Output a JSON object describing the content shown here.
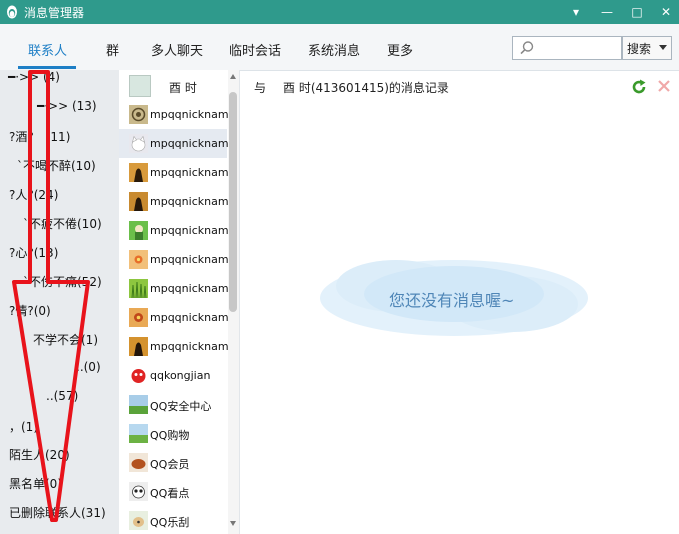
{
  "window": {
    "title": "消息管理器",
    "controls": [
      "▾",
      "—",
      "□",
      "✕"
    ]
  },
  "toolbar": {
    "tabs": [
      {
        "label": "联系人",
        "active": true
      },
      {
        "label": "群"
      },
      {
        "label": "多人聊天"
      },
      {
        "label": "临时会话"
      },
      {
        "label": "系统消息"
      },
      {
        "label": "更多"
      }
    ],
    "search_placeholder": "",
    "search_button": "搜索"
  },
  "left_panel": {
    "items": [
      {
        "label": "━·>> (4)"
      },
      {
        "label": "━·>> (13)"
      },
      {
        "label": "?酒?　(11)"
      },
      {
        "label": "ˋ不喝不醉(10)"
      },
      {
        "label": "?人?(24)"
      },
      {
        "label": "ˋ不疲不倦(10)"
      },
      {
        "label": "?心?(13)"
      },
      {
        "label": "ˋ不伤不痛(52)"
      },
      {
        "label": "?情?(0)"
      },
      {
        "label": "不学不会(1)"
      },
      {
        "label": "..(0)"
      },
      {
        "label": "..(57)"
      },
      {
        "label": "，(1)"
      },
      {
        "label": "陌生人(20)"
      },
      {
        "label": "黑名单(0)"
      },
      {
        "label": "已删除联系人(31)"
      }
    ]
  },
  "contact_list": {
    "header_name": "酉 时",
    "items": [
      {
        "name": "mpqqnickname",
        "avatar": "spiral-avatar"
      },
      {
        "name": "mpqqnickname",
        "avatar": "cat-avatar"
      },
      {
        "name": "mpqqnickname",
        "avatar": "silhouette-avatar"
      },
      {
        "name": "mpqqnickname",
        "avatar": "silhouette-avatar"
      },
      {
        "name": "mpqqnickname",
        "avatar": "green-avatar"
      },
      {
        "name": "mpqqnickname",
        "avatar": "flower-avatar"
      },
      {
        "name": "mpqqnickname",
        "avatar": "grass-avatar"
      },
      {
        "name": "mpqqnickname",
        "avatar": "flower-avatar"
      },
      {
        "name": "mpqqnickname",
        "avatar": "silhouette-avatar"
      },
      {
        "name": "qqkongjian",
        "avatar": "red-avatar"
      },
      {
        "name": "QQ安全中心",
        "avatar": "landscape-avatar"
      },
      {
        "name": "QQ购物",
        "avatar": "landscape-avatar"
      },
      {
        "name": "QQ会员",
        "avatar": "food-avatar"
      },
      {
        "name": "QQ看点",
        "avatar": "panda-avatar"
      },
      {
        "name": "QQ乐刮",
        "avatar": "dog-avatar"
      }
    ]
  },
  "record": {
    "prefix": "与",
    "title": "酉 时(413601415)的消息记录",
    "empty_message": "您还没有消息喔~"
  },
  "colors": {
    "titlebar": "#2f9a8c",
    "accent": "#1e7fc6",
    "arrow": "#e8131b"
  }
}
